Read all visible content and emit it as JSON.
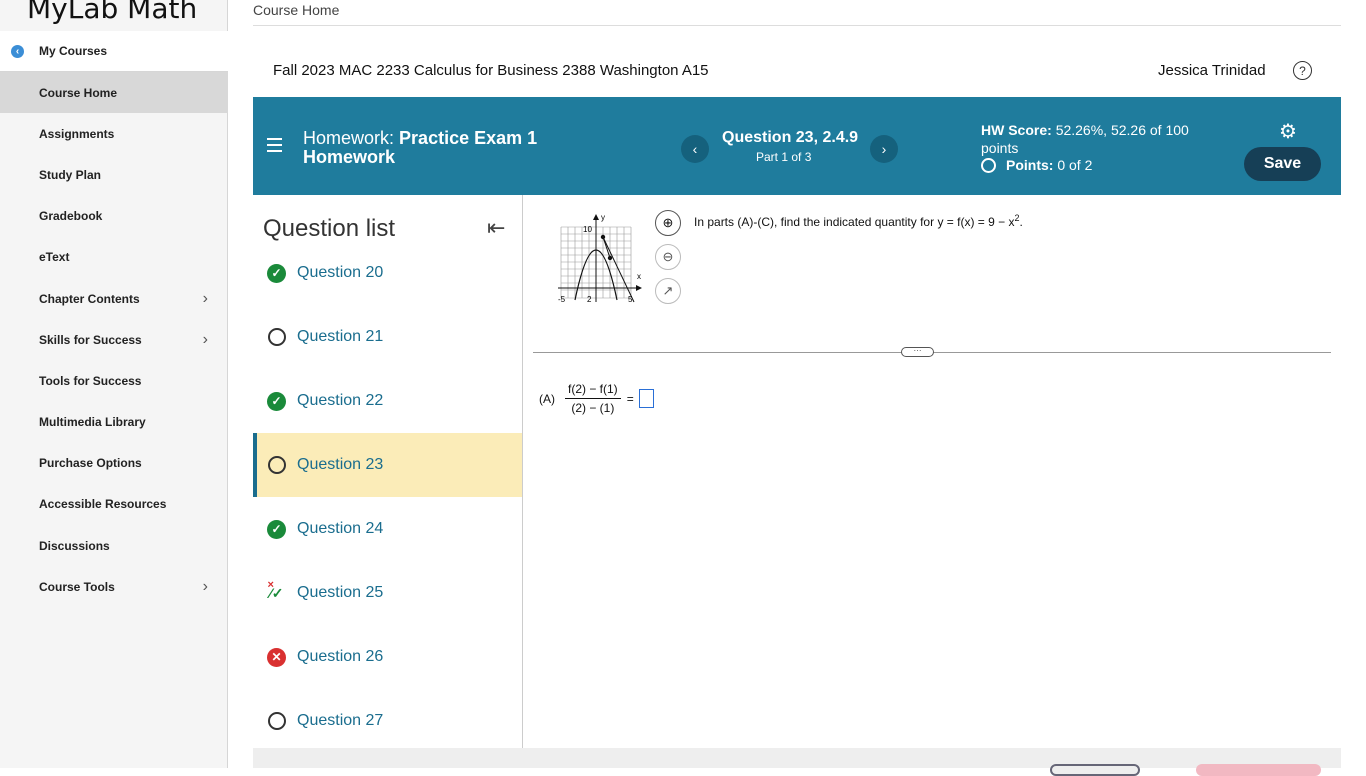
{
  "app": {
    "brand": "MyLab Math"
  },
  "sidebar": {
    "my_courses": "My Courses",
    "items": [
      {
        "label": "Course Home",
        "active": true,
        "chevron": false
      },
      {
        "label": "Assignments",
        "chevron": false
      },
      {
        "label": "Study Plan",
        "chevron": false
      },
      {
        "label": "Gradebook",
        "chevron": false
      },
      {
        "label": "eText",
        "chevron": false
      },
      {
        "label": "Chapter Contents",
        "chevron": true
      },
      {
        "label": "Skills for Success",
        "chevron": true
      },
      {
        "label": "Tools for Success",
        "chevron": false
      },
      {
        "label": "Multimedia Library",
        "chevron": false
      },
      {
        "label": "Purchase Options",
        "chevron": false
      },
      {
        "label": "Accessible Resources",
        "chevron": false
      },
      {
        "label": "Discussions",
        "chevron": false
      },
      {
        "label": "Course Tools",
        "chevron": true
      }
    ]
  },
  "header": {
    "breadcrumb": "Course Home",
    "course_title": "Fall 2023 MAC 2233 Calculus for Business 2388 Washington A15",
    "user_name": "Jessica Trinidad",
    "help_icon": "?"
  },
  "homework_bar": {
    "prefix": "Homework:",
    "name_line1": "Practice Exam 1",
    "name_line2": "Homework",
    "question": "Question 23, 2.4.9",
    "part": "Part 1 of 3",
    "prev": "‹",
    "next": "›",
    "score_label": "HW Score:",
    "score_value": "52.26%, 52.26 of 100",
    "score_unit": "points",
    "points_label": "Points:",
    "points_value": "0 of 2",
    "save": "Save",
    "accent": "#1f7c9d"
  },
  "question_list": {
    "title": "Question list",
    "items": [
      {
        "label": "Question 20",
        "status": "correct"
      },
      {
        "label": "Question 21",
        "status": "unanswered"
      },
      {
        "label": "Question 22",
        "status": "correct"
      },
      {
        "label": "Question 23",
        "status": "unanswered",
        "current": true
      },
      {
        "label": "Question 24",
        "status": "correct"
      },
      {
        "label": "Question 25",
        "status": "partial"
      },
      {
        "label": "Question 26",
        "status": "incorrect"
      },
      {
        "label": "Question 27",
        "status": "unanswered"
      }
    ]
  },
  "problem": {
    "prompt_pre": "In parts (A)-(C), find the indicated quantity for y = f(x) = 9 − x",
    "prompt_exp": "2",
    "prompt_post": ".",
    "graph": {
      "y_label": "y",
      "x_label": "x",
      "y_tick": "10",
      "x_ticks": [
        "-5",
        "2",
        "5"
      ]
    },
    "part_a_label": "(A)",
    "part_a_num": "f(2) − f(1)",
    "part_a_den": "(2) − (1)",
    "equals": "=",
    "divider_dots": "···"
  }
}
